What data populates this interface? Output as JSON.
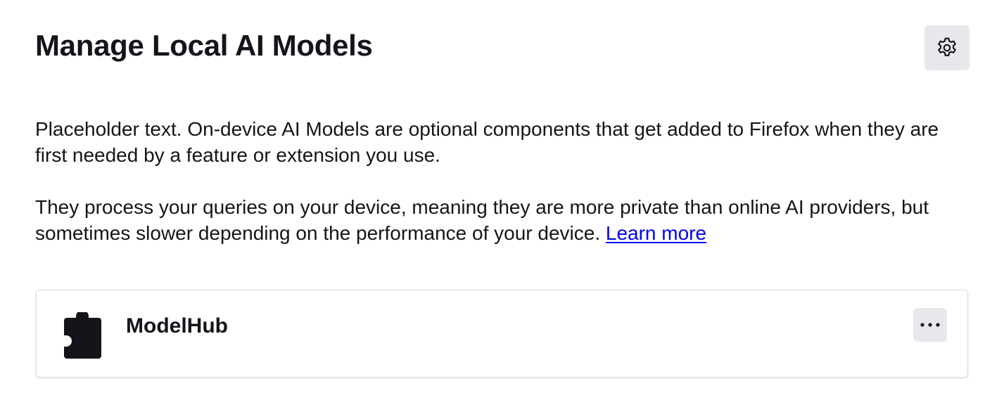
{
  "header": {
    "title": "Manage Local AI Models",
    "settings_icon": "gear-icon"
  },
  "description": {
    "paragraph1": "Placeholder text. On-device AI Models are optional components that get added to Firefox when they are first needed by a feature or extension you use.",
    "paragraph2": "They process your queries on your device, meaning they are more private than online AI providers, but sometimes slower depending on the performance of your device.",
    "learn_more": "Learn more"
  },
  "models": [
    {
      "name": "ModelHub",
      "icon": "puzzle-piece-icon",
      "menu_icon": "more-options-icon"
    }
  ],
  "colors": {
    "link": "#0000ee",
    "button_bg": "#e8e8ec",
    "text": "#15141a"
  }
}
